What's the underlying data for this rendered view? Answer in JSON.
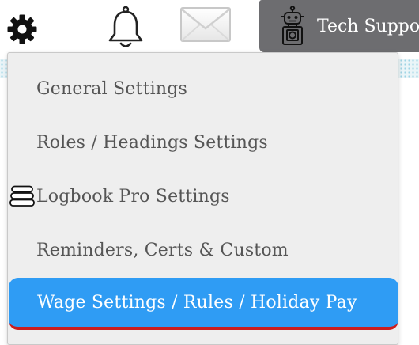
{
  "header": {
    "icons": [
      "gear-icon",
      "bell-icon",
      "mail-icon",
      "robot-icon"
    ],
    "tech_support_label": "Tech Suppo"
  },
  "menu": {
    "items": [
      {
        "label": "General Settings"
      },
      {
        "label": "Roles / Headings Settings"
      },
      {
        "label": "Logbook Pro Settings"
      },
      {
        "label": "Reminders, Certs & Custom"
      },
      {
        "label": "Wage Settings / Rules / Holiday Pay",
        "active": true
      }
    ],
    "side_icon": "stack-icon"
  },
  "colors": {
    "menu_background": "#eeeeee",
    "menu_text": "#555555",
    "active_background": "#2f9cf4",
    "active_text": "#ffffff",
    "active_underline": "#cc1d1d",
    "tech_background": "#6d6d70"
  }
}
